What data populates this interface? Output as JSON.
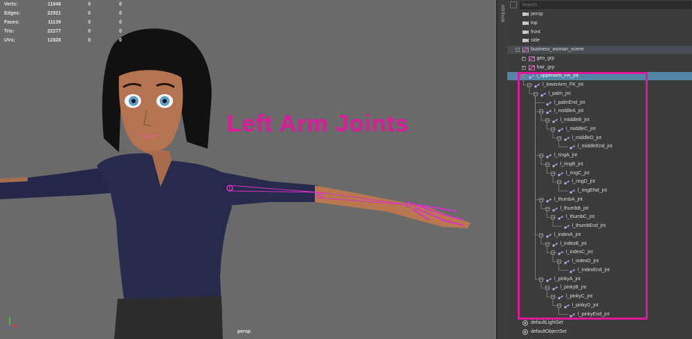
{
  "viewport": {
    "stats": [
      {
        "label": "Verts:",
        "v1": "11848",
        "v2": "0",
        "v3": "0"
      },
      {
        "label": "Edges:",
        "v1": "22921",
        "v2": "0",
        "v3": "0"
      },
      {
        "label": "Faces:",
        "v1": "11139",
        "v2": "0",
        "v3": "0"
      },
      {
        "label": "Tris:",
        "v1": "22277",
        "v2": "0",
        "v3": "0"
      },
      {
        "label": "UVs:",
        "v1": "12828",
        "v2": "0",
        "v3": "0"
      }
    ],
    "overlay_text": "Left Arm Joints",
    "camera_label": "persp",
    "colors": {
      "background": "#6a6a6a",
      "overlay": "#e0189c",
      "joint": "#d833c8"
    }
  },
  "attribute_tab": "Attribute",
  "outliner": {
    "search_placeholder": "Search...",
    "items": [
      {
        "label": "persp",
        "icon": "camera-icon",
        "depth": 0,
        "expander": ""
      },
      {
        "label": "top",
        "icon": "camera-icon",
        "depth": 0,
        "expander": ""
      },
      {
        "label": "front",
        "icon": "camera-icon",
        "depth": 0,
        "expander": ""
      },
      {
        "label": "side",
        "icon": "camera-icon",
        "depth": 0,
        "expander": ""
      },
      {
        "label": "business_woman_scene",
        "icon": "group-icon",
        "depth": 0,
        "expander": "-",
        "style": "hdr"
      },
      {
        "label": "geo_grp",
        "icon": "group-icon",
        "depth": 1,
        "expander": "+"
      },
      {
        "label": "hair_grp",
        "icon": "group-icon",
        "depth": 1,
        "expander": "+"
      },
      {
        "label": "l_upperArm_FK_jnt",
        "icon": "joint-icon",
        "depth": 1,
        "expander": "-",
        "style": "sel"
      },
      {
        "label": "l_lowerArm_FK_jnt",
        "icon": "joint-icon",
        "depth": 2,
        "expander": "-"
      },
      {
        "label": "l_palm_jnt",
        "icon": "joint-icon",
        "depth": 3,
        "expander": "-"
      },
      {
        "label": "l_palmEnd_jnt",
        "icon": "joint-icon",
        "depth": 4,
        "expander": ""
      },
      {
        "label": "l_middleA_jnt",
        "icon": "joint-icon",
        "depth": 4,
        "expander": "-"
      },
      {
        "label": "l_middleB_jnt",
        "icon": "joint-icon",
        "depth": 5,
        "expander": "-"
      },
      {
        "label": "l_middleC_jnt",
        "icon": "joint-icon",
        "depth": 6,
        "expander": "-"
      },
      {
        "label": "l_middleD_jnt",
        "icon": "joint-icon",
        "depth": 7,
        "expander": "-"
      },
      {
        "label": "l_middleEnd_jnt",
        "icon": "joint-icon",
        "depth": 8,
        "expander": ""
      },
      {
        "label": "l_ringA_jnt",
        "icon": "joint-icon",
        "depth": 4,
        "expander": "-"
      },
      {
        "label": "l_ringB_jnt",
        "icon": "joint-icon",
        "depth": 5,
        "expander": "-"
      },
      {
        "label": "l_ringC_jnt",
        "icon": "joint-icon",
        "depth": 6,
        "expander": "-"
      },
      {
        "label": "l_ringD_jnt",
        "icon": "joint-icon",
        "depth": 7,
        "expander": "-"
      },
      {
        "label": "l_ringENd_jnt",
        "icon": "joint-icon",
        "depth": 8,
        "expander": ""
      },
      {
        "label": "l_thumbA_jnt",
        "icon": "joint-icon",
        "depth": 4,
        "expander": "-"
      },
      {
        "label": "l_thumbB_jnt",
        "icon": "joint-icon",
        "depth": 5,
        "expander": "-"
      },
      {
        "label": "l_thumbC_jnt",
        "icon": "joint-icon",
        "depth": 6,
        "expander": "-"
      },
      {
        "label": "l_thumbEnd_jnt",
        "icon": "joint-icon",
        "depth": 7,
        "expander": ""
      },
      {
        "label": "l_indexA_jnt",
        "icon": "joint-icon",
        "depth": 4,
        "expander": "-"
      },
      {
        "label": "l_indexB_jnt",
        "icon": "joint-icon",
        "depth": 5,
        "expander": "-"
      },
      {
        "label": "l_indexC_jnt",
        "icon": "joint-icon",
        "depth": 6,
        "expander": "-"
      },
      {
        "label": "l_indexD_jnt",
        "icon": "joint-icon",
        "depth": 7,
        "expander": "-"
      },
      {
        "label": "l_indexEnd_jnt",
        "icon": "joint-icon",
        "depth": 8,
        "expander": ""
      },
      {
        "label": "l_pinkyA_jnt",
        "icon": "joint-icon",
        "depth": 4,
        "expander": "-"
      },
      {
        "label": "l_pinkyB_jnt",
        "icon": "joint-icon",
        "depth": 5,
        "expander": "-"
      },
      {
        "label": "l_pinkyC_jnt",
        "icon": "joint-icon",
        "depth": 6,
        "expander": "-"
      },
      {
        "label": "l_pinkyD_jnt",
        "icon": "joint-icon",
        "depth": 7,
        "expander": "-"
      },
      {
        "label": "l_pinkyEnd_jnt",
        "icon": "joint-icon",
        "depth": 8,
        "expander": ""
      },
      {
        "label": "defaultLightSet",
        "icon": "set-icon",
        "depth": 0,
        "expander": ""
      },
      {
        "label": "defaultObjectSet",
        "icon": "set-icon",
        "depth": 0,
        "expander": ""
      }
    ],
    "colors": {
      "selected": "#5285a6",
      "highlight_box": "#e0189c"
    }
  }
}
